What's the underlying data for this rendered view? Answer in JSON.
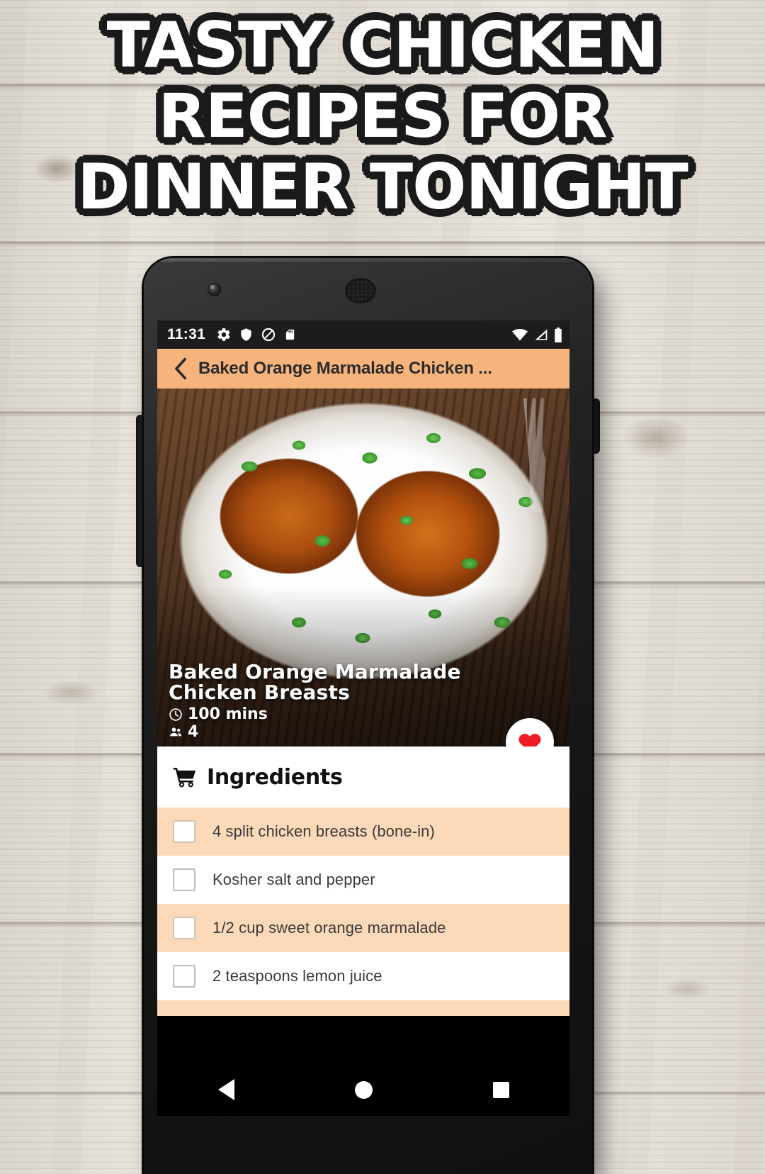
{
  "poster": {
    "headline_lines": [
      "TASTY CHICKEN",
      "RECIPES FOR",
      "DINNER TONIGHT"
    ],
    "background": "whitewashed-wood-planks"
  },
  "phone": {
    "status_bar": {
      "time": "11:31",
      "left_icons": [
        "gear-icon",
        "shield-icon",
        "do-not-disturb-icon",
        "sd-card-icon"
      ],
      "right_icons": [
        "wifi-icon",
        "cellular-signal-icon",
        "battery-icon"
      ]
    },
    "app_bar": {
      "back_icon": "chevron-left-icon",
      "title": "Baked Orange Marmalade Chicken ...",
      "background_color": "#f6b37c"
    },
    "hero": {
      "recipe_title": "Baked Orange Marmalade Chicken Breasts",
      "time_icon": "clock-icon",
      "time_value": "100 mins",
      "servings_icon": "people-icon",
      "servings_value": "4",
      "favorite_icon": "heart-icon",
      "favorite_color": "#ee1c25"
    },
    "ingredients": {
      "section_icon": "shopping-cart-icon",
      "section_title": "Ingredients",
      "items": [
        {
          "text": "4 split chicken breasts (bone-in)",
          "checked": false
        },
        {
          "text": "Kosher salt and pepper",
          "checked": false
        },
        {
          "text": "1/2 cup sweet orange marmalade",
          "checked": false
        },
        {
          "text": "2 teaspoons lemon juice",
          "checked": false
        }
      ],
      "row_alt_color": "#fbd9b9"
    },
    "nav_bar": {
      "back_icon": "triangle-back-icon",
      "home_icon": "circle-home-icon",
      "recents_icon": "square-recents-icon"
    }
  }
}
